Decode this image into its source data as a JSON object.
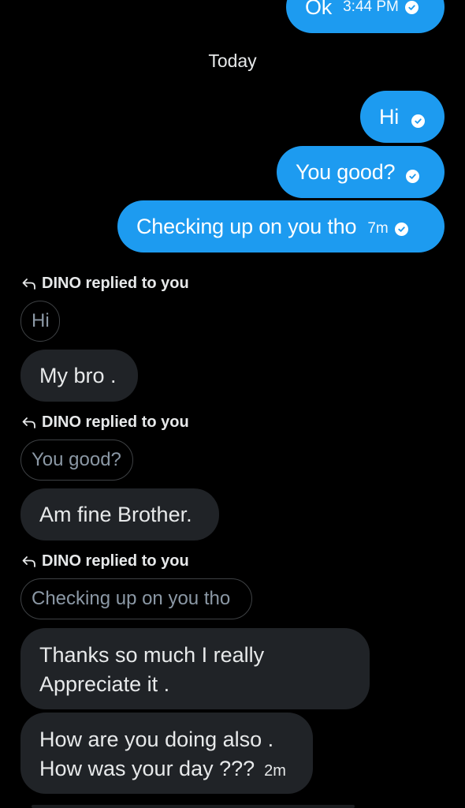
{
  "outgoing": [
    {
      "text": "Ok",
      "time": "3:44 PM"
    },
    {
      "text": "Hi",
      "time": ""
    },
    {
      "text": "You good?",
      "time": ""
    },
    {
      "text": "Checking up on you tho",
      "time": "7m"
    }
  ],
  "date_divider": "Today",
  "incoming": [
    {
      "reply_label": "DINO replied to you",
      "quoted": "Hi",
      "lines": [
        "My bro ."
      ],
      "time": ""
    },
    {
      "reply_label": "DINO replied to you",
      "quoted": "You good?",
      "lines": [
        "Am fine Brother."
      ],
      "time": ""
    },
    {
      "reply_label": "DINO replied to you",
      "quoted": "Checking up on you tho",
      "lines": [
        "Thanks so much I really",
        "Appreciate it ."
      ],
      "time": ""
    },
    {
      "reply_label": "",
      "quoted": "",
      "lines": [
        "How are you doing also .",
        "How was your day ???"
      ],
      "time": "2m"
    }
  ],
  "icons": {
    "sent_check": "check-circle-icon",
    "reply": "reply-arrow-icon"
  },
  "colors": {
    "background": "#000000",
    "outgoing_bubble": "#1d9bf0",
    "incoming_bubble": "#202327",
    "quote_border": "#3e4144",
    "quote_text": "#8b98a5"
  }
}
